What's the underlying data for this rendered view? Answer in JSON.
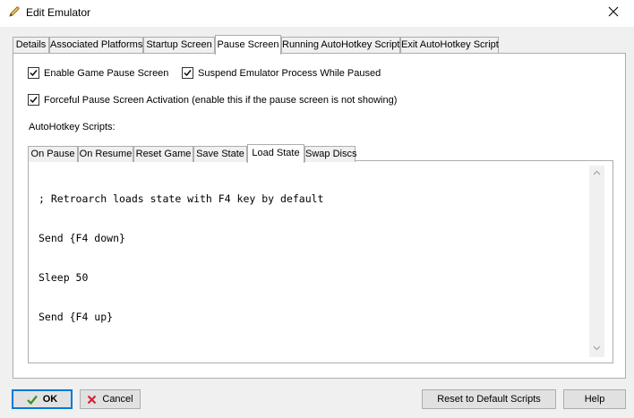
{
  "window": {
    "title": "Edit Emulator"
  },
  "tabs": [
    {
      "label": "Details"
    },
    {
      "label": "Associated Platforms"
    },
    {
      "label": "Startup Screen"
    },
    {
      "label": "Pause Screen"
    },
    {
      "label": "Running AutoHotkey Script"
    },
    {
      "label": "Exit AutoHotkey Script"
    }
  ],
  "active_tab": "Pause Screen",
  "options": {
    "enable_pause": {
      "label": "Enable Game Pause Screen",
      "checked": true
    },
    "suspend_process": {
      "label": "Suspend Emulator Process While Paused",
      "checked": true
    },
    "forceful_activation": {
      "label": "Forceful Pause Screen Activation (enable this if the pause screen is not showing)",
      "checked": true
    }
  },
  "scripts_label": "AutoHotkey Scripts:",
  "script_tabs": [
    {
      "label": "On Pause"
    },
    {
      "label": "On Resume"
    },
    {
      "label": "Reset Game"
    },
    {
      "label": "Save State"
    },
    {
      "label": "Load State"
    },
    {
      "label": "Swap Discs"
    }
  ],
  "active_script_tab": "Load State",
  "script_lines": [
    "; Retroarch loads state with F4 key by default",
    "Send {F4 down}",
    "Sleep 50",
    "Send {F4 up}"
  ],
  "buttons": {
    "ok": "OK",
    "cancel": "Cancel",
    "reset": "Reset to Default Scripts",
    "help": "Help"
  },
  "colors": {
    "accent": "#0078d7",
    "ok_check": "#3a8f1e",
    "cancel_x": "#d0202a"
  },
  "icons": [
    "pencil-icon",
    "close-icon",
    "checkmark-icon",
    "x-icon",
    "scroll-up-arrow",
    "scroll-down-arrow"
  ]
}
